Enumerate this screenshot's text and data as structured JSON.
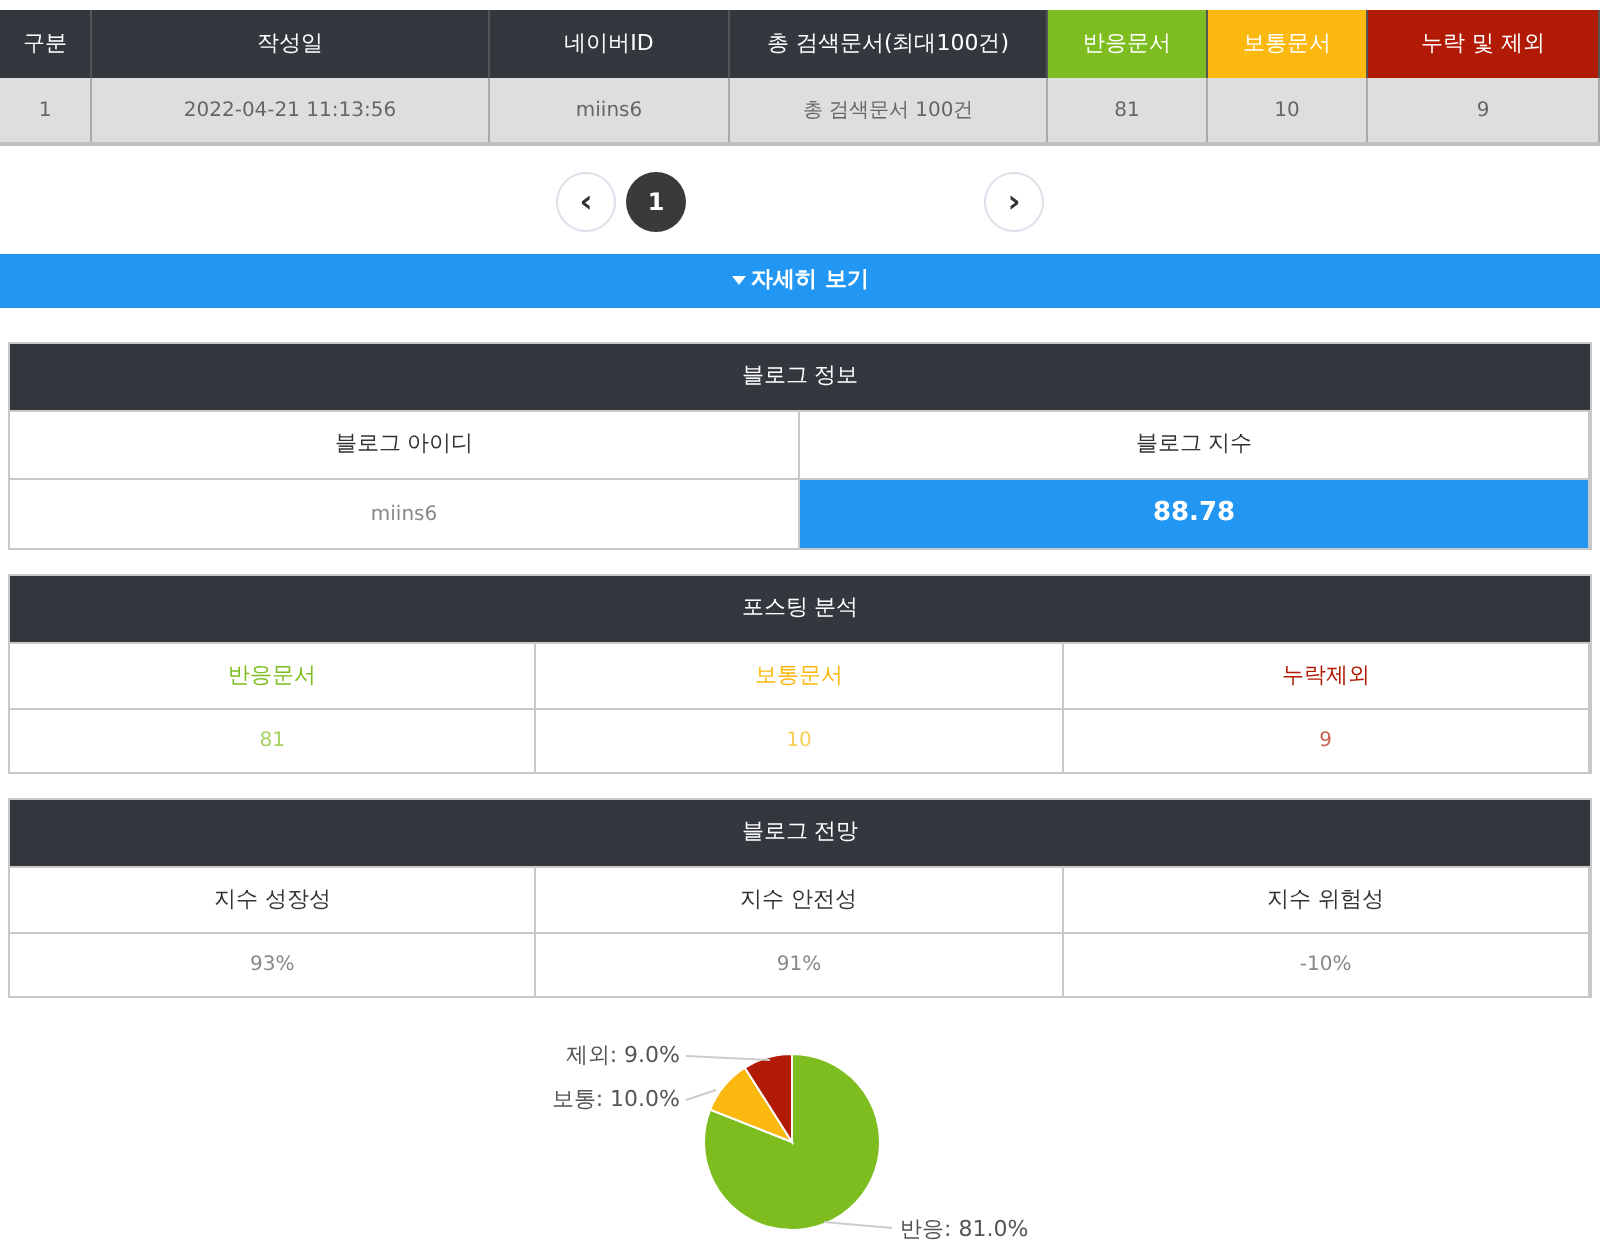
{
  "results_table": {
    "columns": [
      {
        "label": "구분",
        "color": "#33373e"
      },
      {
        "label": "작성일",
        "color": "#33373e"
      },
      {
        "label": "네이버ID",
        "color": "#33373e"
      },
      {
        "label": "총 검색문서(최대100건)",
        "color": "#33373e"
      },
      {
        "label": "반응문서",
        "color": "#7dbd1f"
      },
      {
        "label": "보통문서",
        "color": "#fbb80f"
      },
      {
        "label": "누락 및 제외",
        "color": "#b11a04"
      }
    ],
    "rows": [
      [
        "1",
        "2022-04-21 11:13:56",
        "miins6",
        "총 검색문서 100건",
        "81",
        "10",
        "9"
      ]
    ]
  },
  "pagination": {
    "prev": "‹",
    "pages": [
      {
        "label": "1",
        "selected": true
      }
    ],
    "next": "›"
  },
  "details_bar": {
    "label": "자세히 보기"
  },
  "blog_info": {
    "title": "블로그 정보",
    "columns": [
      "블로그 아이디",
      "블로그 지수"
    ],
    "values": [
      {
        "text": "miins6",
        "highlight": false
      },
      {
        "text": "88.78",
        "highlight": true
      }
    ]
  },
  "posting_analysis": {
    "title": "포스팅 분석",
    "items": [
      {
        "label": "반응문서",
        "value": "81",
        "color": "#7dbd1f"
      },
      {
        "label": "보통문서",
        "value": "10",
        "color": "#fbb80f"
      },
      {
        "label": "누락제외",
        "value": "9",
        "color": "#b11a04"
      }
    ]
  },
  "blog_outlook": {
    "title": "블로그 전망",
    "columns": [
      "지수 성장성",
      "지수 안전성",
      "지수 위험성"
    ],
    "values": [
      "93%",
      "91%",
      "-10%"
    ]
  },
  "chart": {
    "chart_data": {
      "type": "pie",
      "values": [
        81,
        10,
        9
      ],
      "colors": [
        "#7dbd1f",
        "#fbb80f",
        "#b11a04"
      ],
      "value_labels": [
        "반응: 81.0%",
        "보통: 10.0%",
        "제외: 9.0%"
      ]
    }
  }
}
